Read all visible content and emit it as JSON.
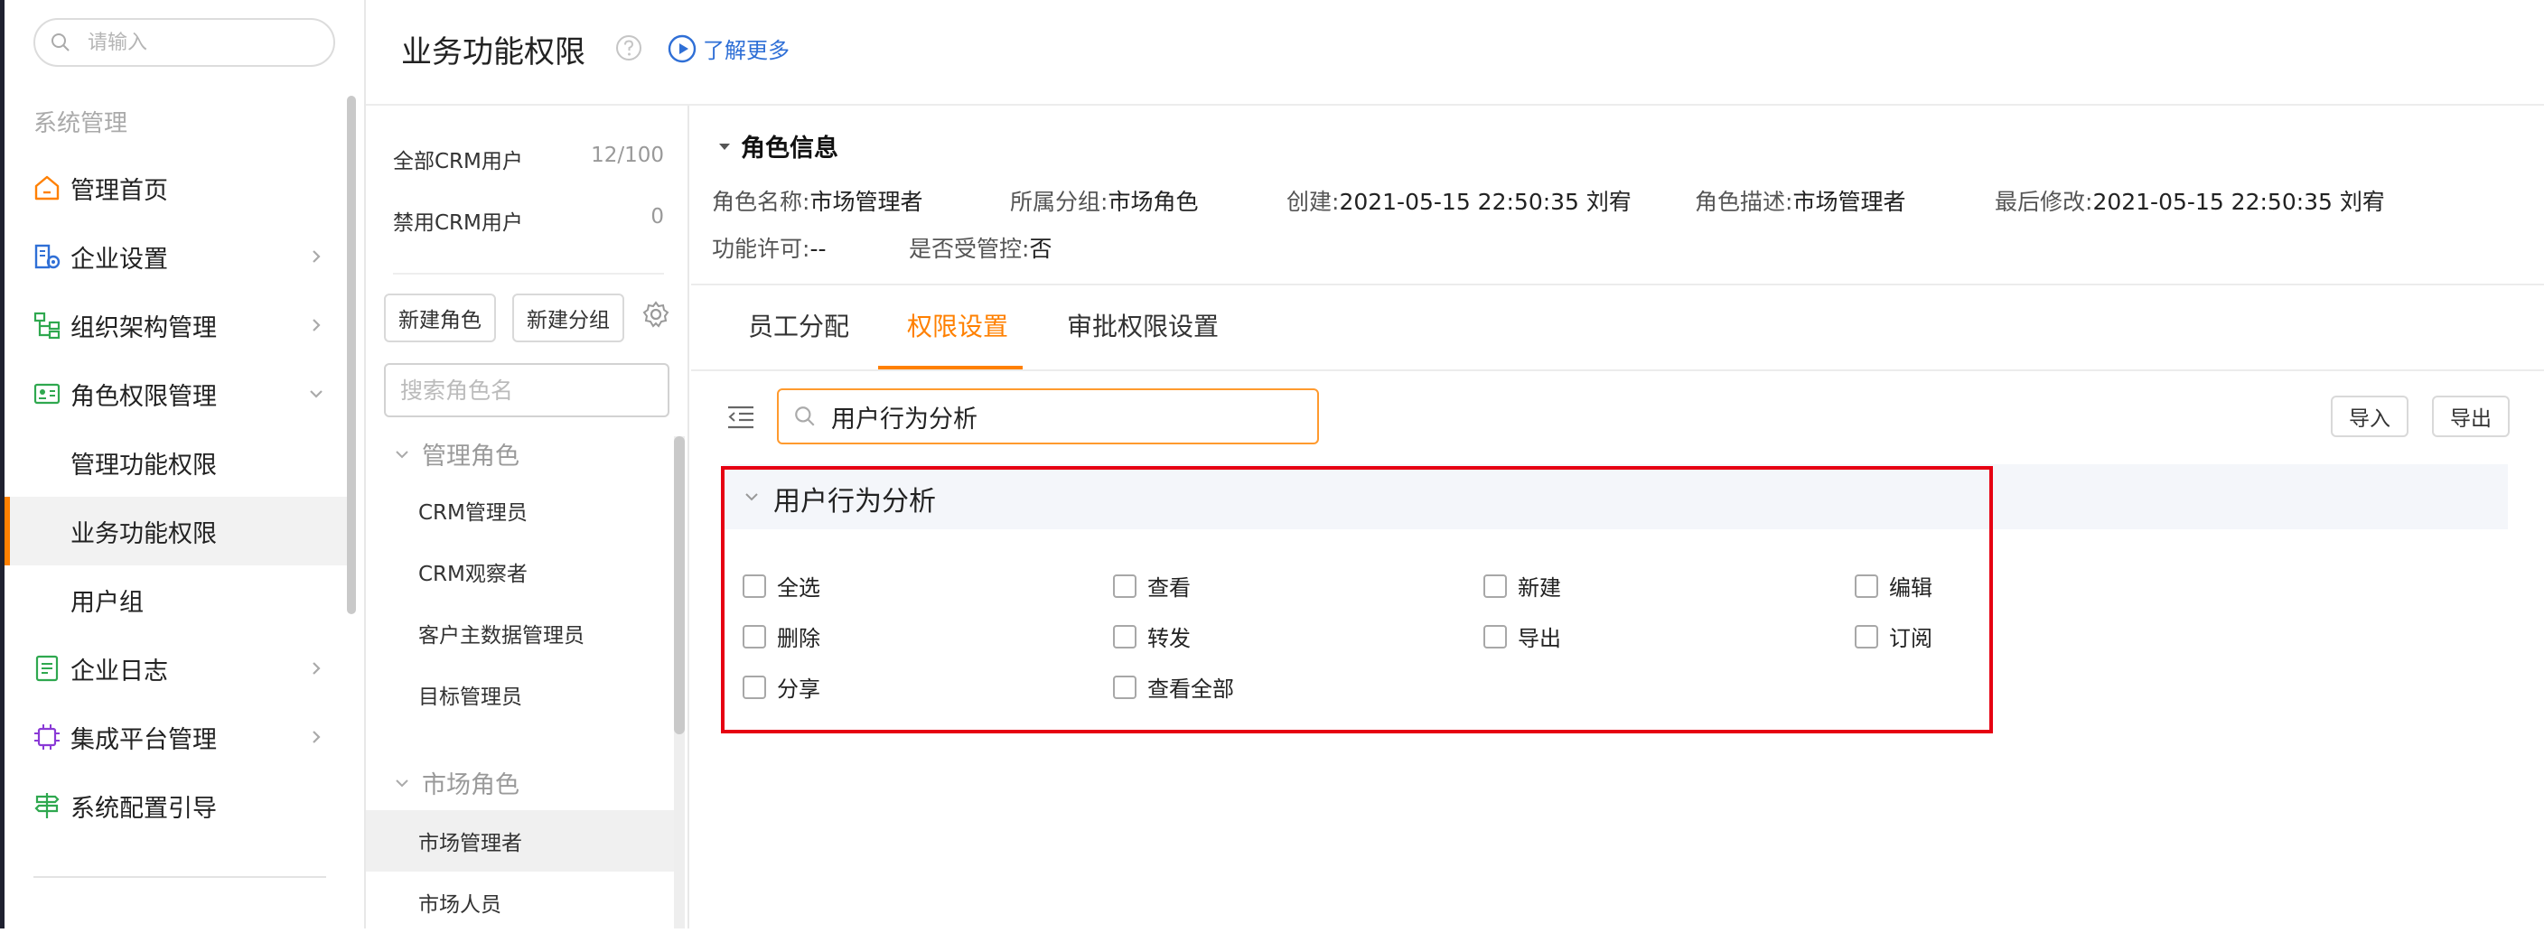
{
  "sidebar": {
    "search_placeholder": "请输入",
    "section_title": "系统管理",
    "items": [
      {
        "label": "管理首页"
      },
      {
        "label": "企业设置"
      },
      {
        "label": "组织架构管理"
      },
      {
        "label": "角色权限管理"
      },
      {
        "label": "管理功能权限"
      },
      {
        "label": "业务功能权限"
      },
      {
        "label": "用户组"
      },
      {
        "label": "企业日志"
      },
      {
        "label": "集成平台管理"
      },
      {
        "label": "系统配置引导"
      }
    ],
    "active_item": "业务功能权限"
  },
  "header": {
    "title": "业务功能权限",
    "learn_more": "了解更多"
  },
  "role_panel": {
    "stats": [
      {
        "label": "全部CRM用户",
        "value": "12/100"
      },
      {
        "label": "禁用CRM用户",
        "value": "0"
      }
    ],
    "new_role_button": "新建角色",
    "new_group_button": "新建分组",
    "search_placeholder": "搜索角色名",
    "groups": [
      {
        "name": "管理角色",
        "roles": [
          "CRM管理员",
          "CRM观察者",
          "客户主数据管理员",
          "目标管理员"
        ]
      },
      {
        "name": "市场角色",
        "roles": [
          "市场管理者",
          "市场人员"
        ]
      }
    ],
    "selected_role": "市场管理者"
  },
  "role_info": {
    "title": "角色信息",
    "fields": [
      {
        "key": "角色名称:",
        "value": "市场管理者"
      },
      {
        "key": "所属分组:",
        "value": "市场角色"
      },
      {
        "key": "创建:",
        "value": "2021-05-15 22:50:35 刘宥"
      },
      {
        "key": "角色描述:",
        "value": "市场管理者"
      },
      {
        "key": "最后修改:",
        "value": "2021-05-15 22:50:35 刘宥"
      },
      {
        "key": "功能许可:",
        "value": "--"
      },
      {
        "key": "是否受管控:",
        "value": "否"
      }
    ]
  },
  "tabs": [
    "员工分配",
    "权限设置",
    "审批权限设置"
  ],
  "active_tab": "权限设置",
  "permissions": {
    "search_value": "用户行为分析",
    "import_button": "导入",
    "export_button": "导出",
    "group_title": "用户行为分析",
    "checkboxes": [
      "全选",
      "查看",
      "新建",
      "编辑",
      "删除",
      "转发",
      "导出",
      "订阅",
      "分享",
      "查看全部"
    ]
  },
  "colors": {
    "accent": "#ff8000",
    "highlight_border": "#e60012",
    "link": "#2f6fd6"
  }
}
